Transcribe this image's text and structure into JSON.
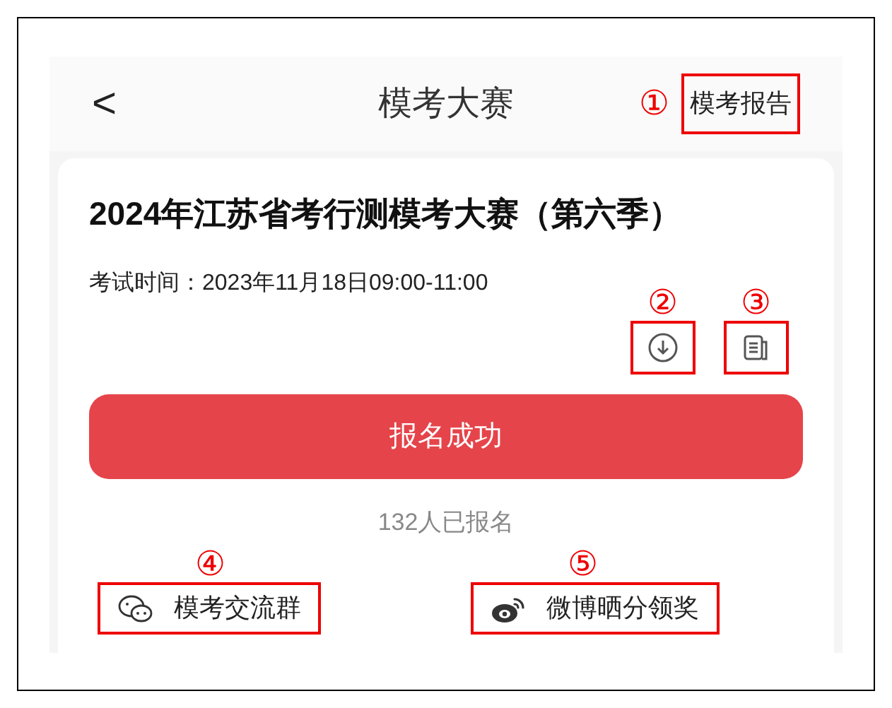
{
  "header": {
    "back": "<",
    "title": "模考大赛",
    "report_link": {
      "label": "模考报告",
      "callout": "①"
    }
  },
  "contest": {
    "title": "2024年江苏省考行测模考大赛（第六季）",
    "exam_time": "考试时间：2023年11月18日09:00-11:00",
    "actions": [
      {
        "kind": "download",
        "callout": "②"
      },
      {
        "kind": "document",
        "callout": "③"
      }
    ],
    "signup_button": "报名成功",
    "signup_count": "132人已报名",
    "share_links": [
      {
        "kind": "chat",
        "label": "模考交流群",
        "callout": "④"
      },
      {
        "kind": "weibo",
        "label": "微博晒分领奖",
        "callout": "⑤"
      }
    ]
  }
}
